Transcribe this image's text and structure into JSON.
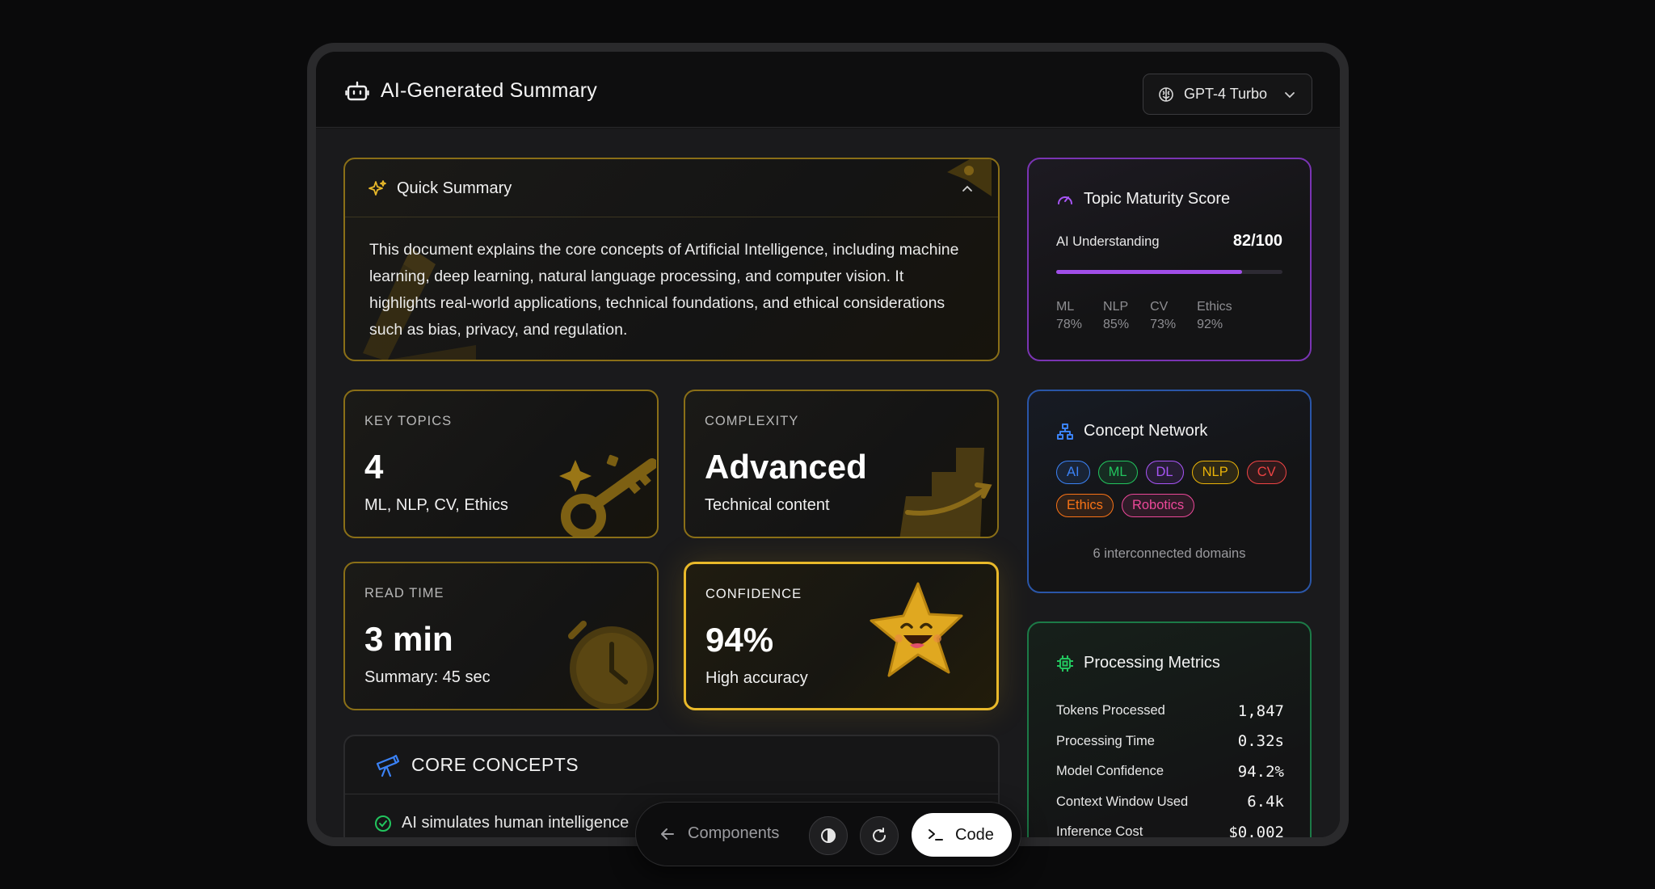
{
  "header": {
    "title": "AI-Generated Summary",
    "model_selector": "GPT-4 Turbo"
  },
  "quick_summary": {
    "title": "Quick Summary",
    "text": "This document explains the core concepts of Artificial Intelligence, including machine learning, deep learning, natural language processing, and computer vision. It highlights real-world applications, technical foundations, and ethical considerations such as bias, privacy, and regulation."
  },
  "stats": [
    {
      "caption": "KEY TOPICS",
      "value": "4",
      "sub": "ML, NLP, CV, Ethics"
    },
    {
      "caption": "COMPLEXITY",
      "value": "Advanced",
      "sub": "Technical content"
    },
    {
      "caption": "READ TIME",
      "value": "3 min",
      "sub": "Summary: 45 sec"
    },
    {
      "caption": "CONFIDENCE",
      "value": "94%",
      "sub": "High accuracy"
    }
  ],
  "core_concepts": {
    "title": "CORE CONCEPTS",
    "first_item": "AI simulates human intelligence"
  },
  "maturity": {
    "title": "Topic Maturity Score",
    "label": "AI Understanding",
    "score": "82/100",
    "progress": 0.82,
    "breakdown": [
      {
        "name": "ML",
        "value": "78%"
      },
      {
        "name": "NLP",
        "value": "85%"
      },
      {
        "name": "CV",
        "value": "73%"
      },
      {
        "name": "Ethics",
        "value": "92%"
      }
    ]
  },
  "concept_network": {
    "title": "Concept Network",
    "chips": [
      {
        "label": "AI",
        "color": "#3b82f6"
      },
      {
        "label": "ML",
        "color": "#22c55e"
      },
      {
        "label": "DL",
        "color": "#a855f7"
      },
      {
        "label": "NLP",
        "color": "#eab308"
      },
      {
        "label": "CV",
        "color": "#ef4444"
      },
      {
        "label": "Ethics",
        "color": "#f97316"
      },
      {
        "label": "Robotics",
        "color": "#ec4899"
      }
    ],
    "footer": "6 interconnected domains"
  },
  "processing": {
    "title": "Processing Metrics",
    "rows": [
      {
        "key": "Tokens Processed",
        "value": "1,847"
      },
      {
        "key": "Processing Time",
        "value": "0.32s"
      },
      {
        "key": "Model Confidence",
        "value": "94.2%"
      },
      {
        "key": "Context Window Used",
        "value": "6.4k"
      },
      {
        "key": "Inference Cost",
        "value": "$0.002"
      }
    ]
  },
  "dock": {
    "back_label": "Components",
    "code_label": "Code"
  },
  "colors": {
    "gold": "#e9b92a",
    "purple": "#7a34b3",
    "blue": "#2a56a8",
    "green": "#1c7a47"
  }
}
